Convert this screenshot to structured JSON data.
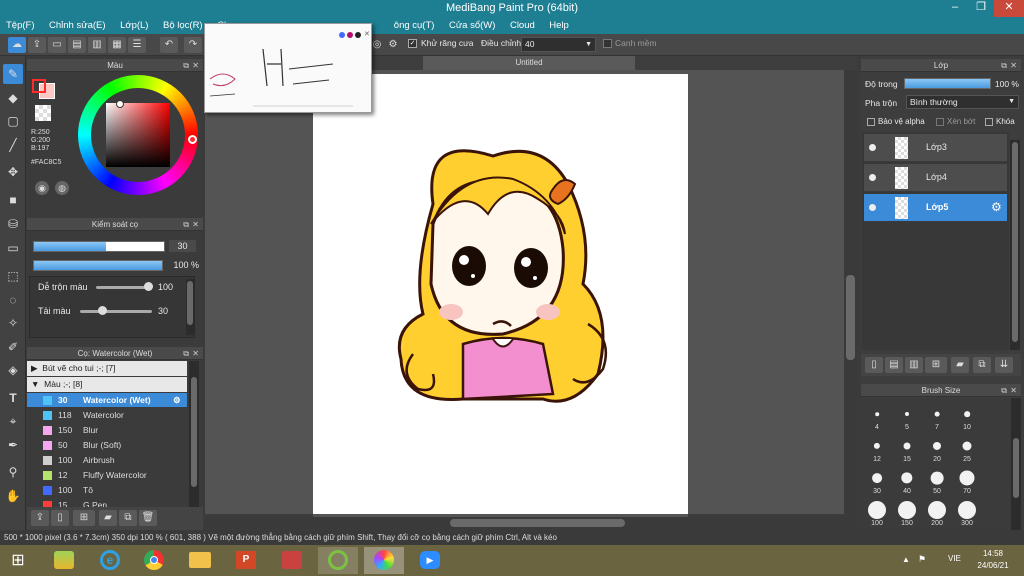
{
  "title": "MediBang Paint Pro (64bit)",
  "window_controls": [
    "–",
    "❐",
    "✕"
  ],
  "menu": [
    "Tệp(F)",
    "Chỉnh sửa(E)",
    "Lớp(L)",
    "Bộ lọc(R)",
    "Ch",
    "ông cụ(T)",
    "Cửa sổ(W)",
    "Cloud",
    "Help"
  ],
  "toolbar": {
    "antialias_label": "Khử răng cưa",
    "adjust_label": "Điều chỉnh",
    "adjust_value": "40",
    "snap_label": "Canh mềm"
  },
  "color_panel": {
    "title": "Màu",
    "r": "R:250",
    "g": "G:200",
    "b": "B:197",
    "hex": "#FAC8C5",
    "fg_color": "#fac8c5"
  },
  "brush_control": {
    "title": "Kiểm soát cọ",
    "size_value": "30",
    "opacity_value": "100 %",
    "blend_label": "Dễ trộn màu",
    "blend_value": "100",
    "amount_label": "Tải màu",
    "amount_value": "30"
  },
  "brush_panel": {
    "title": "Cọ: Watercolor (Wet)",
    "groups": [
      {
        "label": "Bút vẽ cho tui ;-; [7]",
        "expanded": false
      },
      {
        "label": "Màu ;-; [8]",
        "expanded": true
      }
    ],
    "items": [
      {
        "size": "30",
        "name": "Watercolor (Wet)",
        "color": "#4fc3f7",
        "selected": true
      },
      {
        "size": "118",
        "name": "Watercolor",
        "color": "#4fc3f7",
        "selected": false
      },
      {
        "size": "150",
        "name": "Blur",
        "color": "#f7a6f0",
        "selected": false
      },
      {
        "size": "50",
        "name": "Blur (Soft)",
        "color": "#f7a6f0",
        "selected": false
      },
      {
        "size": "100",
        "name": "Airbrush",
        "color": "#cfcfcf",
        "selected": false
      },
      {
        "size": "12",
        "name": "Fluffy Watercolor",
        "color": "#b4e26b",
        "selected": false
      },
      {
        "size": "100",
        "name": "Tô",
        "color": "#3f6bff",
        "selected": false
      },
      {
        "size": "15",
        "name": "G Pen",
        "color": "#ff3b3b",
        "selected": false
      }
    ]
  },
  "document": {
    "tab_title": "Untitled"
  },
  "layer_panel": {
    "title": "Lớp",
    "opacity_label": "Độ trong",
    "opacity_value": "100 %",
    "opacity_level": 1.0,
    "blend_label": "Pha trộn",
    "blend_value": "Bình thường",
    "protect_alpha": "Bảo vệ alpha",
    "clip": "Xén bớt",
    "lock": "Khóa",
    "layers": [
      {
        "name": "Lớp3",
        "selected": false
      },
      {
        "name": "Lớp4",
        "selected": false
      },
      {
        "name": "Lớp5",
        "selected": true
      }
    ]
  },
  "brush_size_panel": {
    "title": "Brush Size",
    "sizes": [
      "4",
      "5",
      "7",
      "10",
      "12",
      "15",
      "20",
      "25",
      "30",
      "40",
      "50",
      "70",
      "100",
      "150",
      "200",
      "300"
    ]
  },
  "status": "500 * 1000 pixel   (3.6 * 7.3cm)   350 dpi   100 %   ( 601, 388 )   Vẽ một đường thẳng bằng cách giữ phím Shift, Thay đổi cỡ cọ bằng cách giữ phím Ctrl, Alt và kéo",
  "taskbar": {
    "lang": "VIE",
    "time": "14:58",
    "date": "24/06/21"
  }
}
